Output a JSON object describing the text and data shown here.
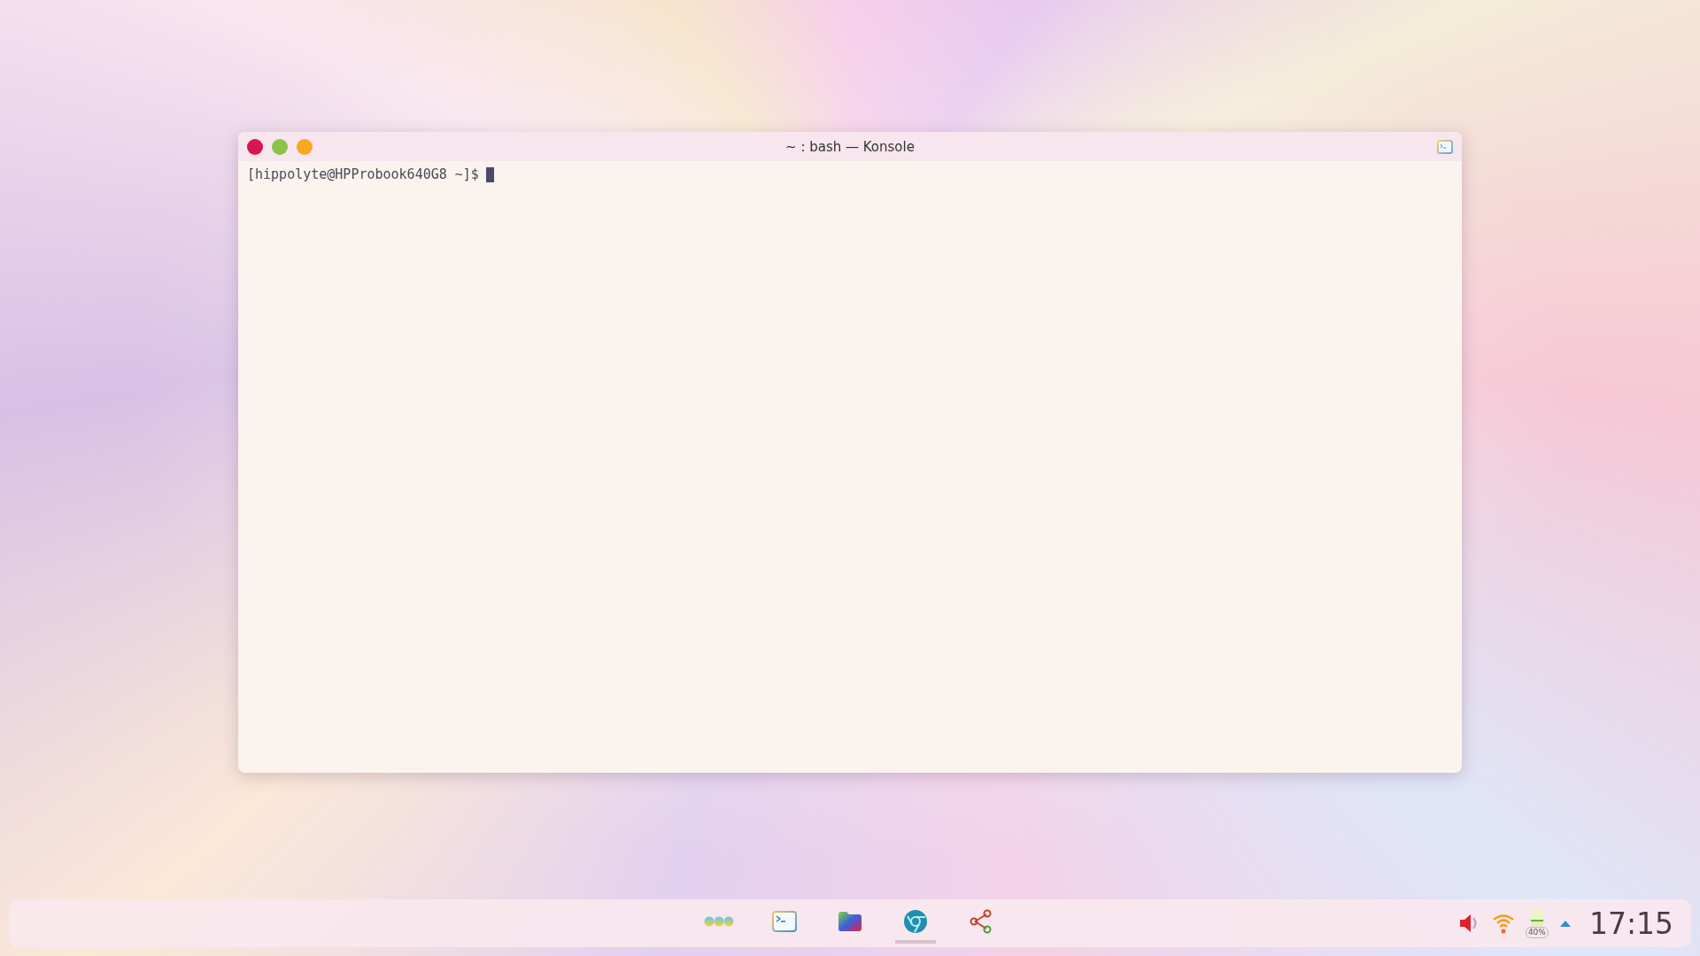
{
  "window": {
    "title": "~ : bash — Konsole",
    "prompt": "[hippolyte@HPProbook640G8 ~]$"
  },
  "taskbar": {
    "tasks": [
      {
        "kind": "launcher",
        "selected": false
      },
      {
        "kind": "terminal",
        "selected": false
      },
      {
        "kind": "files",
        "selected": false
      },
      {
        "kind": "browser",
        "selected": true
      },
      {
        "kind": "share",
        "selected": false
      }
    ],
    "tray": {
      "battery_label": "40%",
      "clock": "17:15"
    }
  }
}
